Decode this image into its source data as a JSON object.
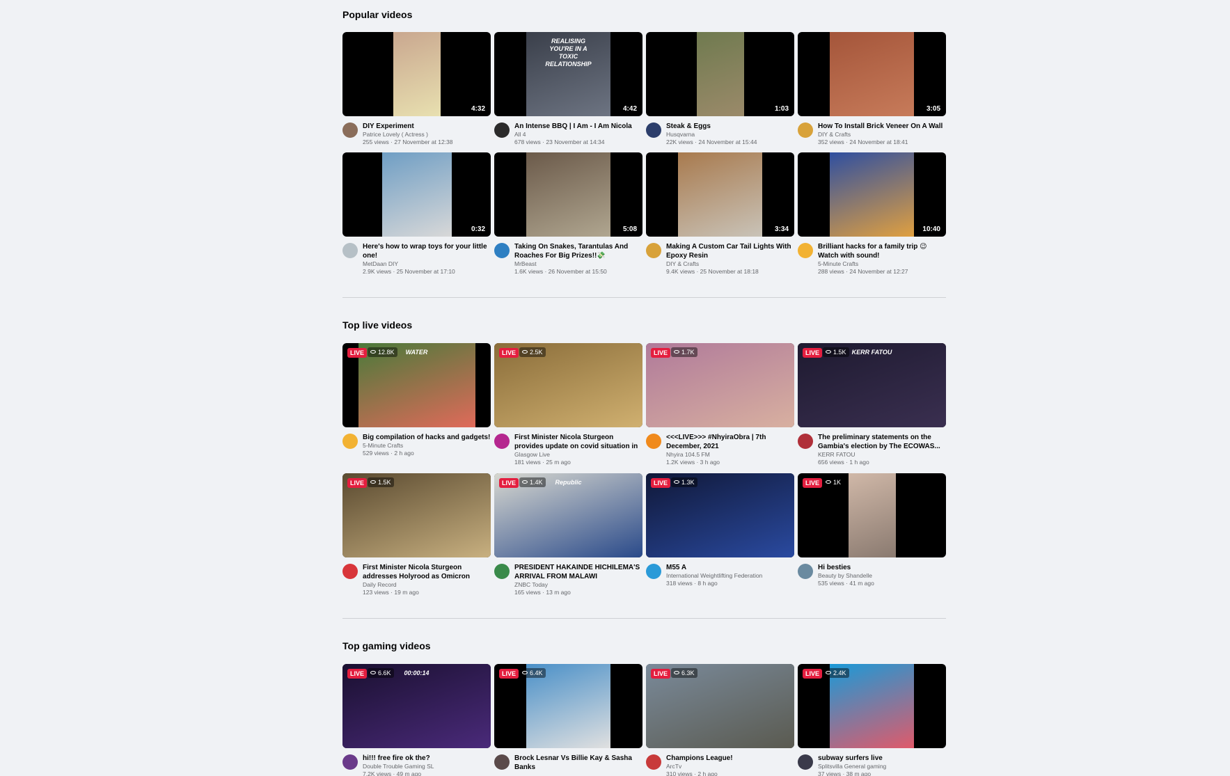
{
  "sections": [
    {
      "title": "Popular videos",
      "kind": "popular",
      "videos": [
        {
          "title": "DIY Experiment",
          "channel": "Patrice Lovely ( Actress )",
          "views": "255 views",
          "time": "27 November at 12:38",
          "duration": "4:32",
          "avatar_color": "#8a6d5a",
          "thumb_colors": [
            "#c9a78f",
            "#e8e0b0"
          ],
          "thumb_side": "center",
          "thumb_width_ratio": 0.32
        },
        {
          "title": "An Intense BBQ | I Am - I Am Nicola",
          "channel": "All 4",
          "views": "678 views",
          "time": "23 November at 14:34",
          "duration": "4:42",
          "avatar_color": "#2b2b2b",
          "thumb_colors": [
            "#3a3f4a",
            "#6d7482"
          ],
          "thumb_side": "center",
          "thumb_width_ratio": 0.57,
          "thumb_text": "REALISING YOU'RE IN A TOXIC RELATIONSHIP"
        },
        {
          "title": "Steak & Eggs",
          "channel": "Husqvarna",
          "views": "22K views",
          "time": "24 November at 15:44",
          "duration": "1:03",
          "avatar_color": "#2c3e6b",
          "thumb_colors": [
            "#6f7a4f",
            "#9b8a6a"
          ],
          "thumb_side": "center",
          "thumb_width_ratio": 0.32
        },
        {
          "title": "How To Install Brick Veneer On A Wall",
          "channel": "DIY & Crafts",
          "views": "352 views",
          "time": "24 November at 18:41",
          "duration": "3:05",
          "avatar_color": "#d8a23a",
          "thumb_colors": [
            "#a4553a",
            "#c77b5a"
          ],
          "thumb_side": "center",
          "thumb_width_ratio": 0.57
        }
      ]
    },
    {
      "title": "",
      "kind": "popular2",
      "videos": [
        {
          "title": "Here's how to wrap toys for your little one!",
          "channel": "MetDaan DIY",
          "views": "2.9K views",
          "time": "25 November at 17:10",
          "duration": "0:32",
          "avatar_color": "#b6c0c6",
          "thumb_colors": [
            "#6f9ec4",
            "#d8d8d8"
          ],
          "thumb_side": "center",
          "thumb_width_ratio": 0.47
        },
        {
          "title": "Taking On Snakes, Tarantulas And Roaches For Big Prizes!!💸",
          "channel": "MrBeast",
          "views": "1.6K views",
          "time": "26 November at 15:50",
          "duration": "5:08",
          "avatar_color": "#2e7fc2",
          "thumb_colors": [
            "#6b5a4a",
            "#b0a690"
          ],
          "thumb_side": "center",
          "thumb_width_ratio": 0.57
        },
        {
          "title": "Making A Custom Car Tail Lights With Epoxy Resin",
          "channel": "DIY & Crafts",
          "views": "9.4K views",
          "time": "25 November at 18:18",
          "duration": "3:34",
          "avatar_color": "#d8a23a",
          "thumb_colors": [
            "#a87a4e",
            "#c9c3b8"
          ],
          "thumb_side": "center",
          "thumb_width_ratio": 0.57
        },
        {
          "title": "Brilliant hacks for a family trip 😉 Watch with sound!",
          "channel": "5-Minute Crafts",
          "views": "288 views",
          "time": "24 November at 12:27",
          "duration": "10:40",
          "avatar_color": "#f2b233",
          "thumb_colors": [
            "#2f4fa0",
            "#e0a040"
          ],
          "thumb_side": "center",
          "thumb_width_ratio": 0.57
        }
      ]
    },
    {
      "title": "Top live videos",
      "kind": "live",
      "videos": [
        {
          "title": "Big compilation of hacks and gadgets!",
          "channel": "5-Minute Crafts",
          "views": "529 views",
          "time": "2 h ago",
          "viewers": "12.8K",
          "avatar_color": "#f2b233",
          "thumb_colors": [
            "#4a7a3a",
            "#e06a5a"
          ],
          "thumb_side": "center",
          "thumb_width_ratio": 0.79,
          "thumb_text": "WATER"
        },
        {
          "title": "First Minister Nicola Sturgeon provides update on covid situation in Scotland",
          "channel": "Glasgow Live",
          "views": "181 views",
          "time": "25 m ago",
          "viewers": "2.5K",
          "avatar_color": "#b5278f",
          "thumb_colors": [
            "#8a6d3a",
            "#d0b070"
          ],
          "thumb_side": "full",
          "thumb_width_ratio": 1
        },
        {
          "title": "<<<LIVE>>> #NhyiraObra | 7th December, 2021",
          "channel": "Nhyira 104.5 FM",
          "views": "1.2K views",
          "time": "3 h ago",
          "viewers": "1.7K",
          "avatar_color": "#f08a1c",
          "thumb_colors": [
            "#b07a9a",
            "#d8b0a0"
          ],
          "thumb_side": "full",
          "thumb_width_ratio": 1
        },
        {
          "title": "The preliminary statements on the Gambia's election by The ECOWAS...",
          "channel": "KERR FATOU",
          "views": "656 views",
          "time": "1 h ago",
          "viewers": "1.5K",
          "avatar_color": "#b0303a",
          "thumb_colors": [
            "#1e1a30",
            "#3a2f50"
          ],
          "thumb_side": "full",
          "thumb_width_ratio": 1,
          "thumb_text": "KERR FATOU"
        }
      ]
    },
    {
      "title": "",
      "kind": "live2",
      "videos": [
        {
          "title": "First Minister Nicola Sturgeon addresses Holyrood as Omicron case...",
          "channel": "Daily Record",
          "views": "123 views",
          "time": "19 m ago",
          "viewers": "1.5K",
          "avatar_color": "#d8353a",
          "thumb_colors": [
            "#5a4a30",
            "#c8b080"
          ],
          "thumb_side": "full",
          "thumb_width_ratio": 1
        },
        {
          "title": "PRESIDENT HAKAINDE HICHILEMA'S ARRIVAL FROM MALAWI",
          "channel": "ZNBC Today",
          "views": "165 views",
          "time": "13 m ago",
          "viewers": "1.4K",
          "avatar_color": "#3a8a4a",
          "thumb_colors": [
            "#d8d8d0",
            "#2a4a8a"
          ],
          "thumb_side": "full",
          "thumb_width_ratio": 1,
          "thumb_text": "Republic"
        },
        {
          "title": "M55 A",
          "channel": "International Weightlifting Federation",
          "views": "318 views",
          "time": "8 h ago",
          "viewers": "1.3K",
          "avatar_color": "#2a9ad8",
          "thumb_colors": [
            "#101838",
            "#2a4aa0"
          ],
          "thumb_side": "full",
          "thumb_width_ratio": 1
        },
        {
          "title": "Hi besties",
          "channel": "Beauty by Shandelle",
          "views": "535 views",
          "time": "41 m ago",
          "viewers": "1K",
          "avatar_color": "#6a8aa0",
          "thumb_colors": [
            "#d0b8a8",
            "#8a7a70"
          ],
          "thumb_side": "center",
          "thumb_width_ratio": 0.32
        }
      ]
    },
    {
      "title": "Top gaming videos",
      "kind": "gaming",
      "videos": [
        {
          "title": "hi!!! free fire ok the?",
          "channel": "Double Trouble Gaming SL",
          "views": "7.2K views",
          "time": "49 m ago",
          "viewers": "6.6K",
          "avatar_color": "#6a3a8a",
          "thumb_colors": [
            "#1a1030",
            "#4a2a7a"
          ],
          "thumb_side": "full",
          "thumb_width_ratio": 1,
          "thumb_text": "00:00:14"
        },
        {
          "title": "Brock Lesnar Vs Billie Kay & Sasha Banks",
          "channel": "",
          "views": "",
          "time": "",
          "viewers": "6.4K",
          "avatar_color": "#5a4a4a",
          "thumb_colors": [
            "#4a90c8",
            "#e0e0e0"
          ],
          "thumb_side": "center",
          "thumb_width_ratio": 0.57
        },
        {
          "title": "Champions League!",
          "channel": "ArcTv",
          "views": "310 views",
          "time": "2 h ago",
          "viewers": "6.3K",
          "avatar_color": "#c83a3a",
          "thumb_colors": [
            "#7a8a9a",
            "#5a5a50"
          ],
          "thumb_side": "full",
          "thumb_width_ratio": 1
        },
        {
          "title": "subway surfers live",
          "channel": "Splitsvilla General gaming",
          "views": "37 views",
          "time": "38 m ago",
          "viewers": "2.4K",
          "avatar_color": "#3a3a4a",
          "thumb_colors": [
            "#1a9ad8",
            "#e05a6a"
          ],
          "thumb_side": "center",
          "thumb_width_ratio": 0.57
        }
      ]
    }
  ],
  "live_label": "LIVE"
}
